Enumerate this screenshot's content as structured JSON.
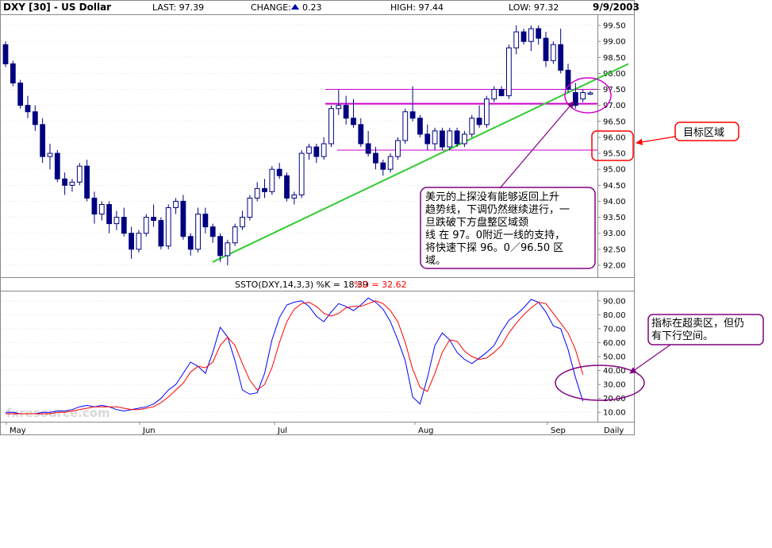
{
  "header": {
    "title": "DXY [30] - US Dollar",
    "last": "LAST: 97.39",
    "change_label": "CHANGE:",
    "change_value": "0.23",
    "high": "HIGH: 97.44",
    "low": "LOW: 97.32",
    "date": "9/9/2003"
  },
  "indicator_header": {
    "label": "SSTO(DXY,14,3,3) %K = 18.39",
    "d_label": "%D = 32.62"
  },
  "x_axis": {
    "labels": [
      "May",
      "Jun",
      "Jul",
      "Aug",
      "Sep"
    ],
    "period": "Daily"
  },
  "watermark": "fxresource.com",
  "annotations": {
    "target_zone": "目标区域",
    "main_note": [
      "美元的上探没有能够返回上升",
      "趋势线，下调仍然继续进行，一",
      "旦跌破下方盘整区域颈",
      "线  在  97。0附近一线的支持，",
      "将快速下探  96。0／96.50  区",
      "域。"
    ],
    "indicator_note": [
      "指标在超卖区，但仍",
      "有下行空间。"
    ]
  },
  "colors": {
    "candle": "#000080",
    "trendline": "#33cc33",
    "resistance": "#cc00cc",
    "k_line": "#0000ff",
    "d_line": "#ff0000",
    "annotation": "#800080",
    "target": "#ff0000"
  },
  "chart_data": [
    {
      "type": "candlestick",
      "title": "DXY [30] - US Dollar",
      "period": "Daily",
      "y_ticks": [
        "99.50",
        "99.00",
        "98.50",
        "98.00",
        "97.50",
        "97.00",
        "96.50",
        "96.00",
        "95.50",
        "95.00",
        "94.50",
        "94.00",
        "93.50",
        "93.00",
        "92.50",
        "92.00"
      ],
      "ylim": [
        91.8,
        99.7
      ],
      "x_labels": [
        "May",
        "Jun",
        "Jul",
        "Aug",
        "Sep"
      ],
      "ohlc": [
        [
          98.9,
          99.0,
          98.2,
          98.3
        ],
        [
          98.3,
          98.4,
          97.6,
          97.7
        ],
        [
          97.7,
          97.8,
          96.9,
          97.0
        ],
        [
          97.0,
          97.3,
          96.6,
          96.8
        ],
        [
          96.8,
          97.0,
          96.2,
          96.4
        ],
        [
          96.4,
          96.6,
          95.2,
          95.4
        ],
        [
          95.4,
          95.8,
          95.0,
          95.5
        ],
        [
          95.5,
          95.6,
          94.6,
          94.7
        ],
        [
          94.7,
          94.9,
          94.2,
          94.5
        ],
        [
          94.5,
          94.7,
          94.3,
          94.6
        ],
        [
          94.6,
          95.2,
          94.5,
          95.1
        ],
        [
          95.1,
          95.3,
          94.0,
          94.1
        ],
        [
          94.1,
          94.3,
          93.3,
          93.6
        ],
        [
          93.6,
          94.0,
          93.4,
          93.9
        ],
        [
          93.9,
          94.0,
          93.0,
          93.3
        ],
        [
          93.3,
          93.7,
          93.1,
          93.5
        ],
        [
          93.5,
          93.8,
          92.9,
          93.0
        ],
        [
          93.0,
          93.2,
          92.2,
          92.5
        ],
        [
          92.5,
          93.1,
          92.4,
          93.0
        ],
        [
          93.0,
          93.6,
          92.9,
          93.5
        ],
        [
          93.5,
          93.9,
          93.2,
          93.4
        ],
        [
          93.4,
          93.5,
          92.5,
          92.6
        ],
        [
          92.6,
          93.9,
          92.5,
          93.8
        ],
        [
          93.8,
          94.1,
          93.6,
          94.0
        ],
        [
          94.0,
          94.2,
          92.8,
          92.9
        ],
        [
          92.9,
          93.0,
          92.3,
          92.5
        ],
        [
          92.5,
          93.8,
          92.4,
          93.6
        ],
        [
          93.6,
          93.8,
          93.0,
          93.2
        ],
        [
          93.2,
          93.3,
          92.7,
          92.9
        ],
        [
          92.9,
          93.0,
          92.1,
          92.3
        ],
        [
          92.3,
          92.8,
          92.0,
          92.7
        ],
        [
          92.7,
          93.3,
          92.6,
          93.2
        ],
        [
          93.2,
          93.7,
          93.1,
          93.5
        ],
        [
          93.5,
          94.2,
          93.4,
          94.1
        ],
        [
          94.1,
          94.6,
          94.0,
          94.4
        ],
        [
          94.4,
          94.7,
          94.1,
          94.3
        ],
        [
          94.3,
          95.1,
          94.2,
          95.0
        ],
        [
          95.0,
          95.2,
          94.7,
          94.8
        ],
        [
          94.8,
          94.9,
          94.0,
          94.1
        ],
        [
          94.1,
          94.3,
          93.9,
          94.2
        ],
        [
          94.2,
          95.6,
          94.1,
          95.5
        ],
        [
          95.5,
          95.8,
          95.3,
          95.7
        ],
        [
          95.7,
          95.8,
          95.2,
          95.4
        ],
        [
          95.4,
          96.0,
          95.3,
          95.8
        ],
        [
          95.8,
          97.0,
          95.7,
          96.9
        ],
        [
          96.9,
          97.5,
          96.7,
          97.0
        ],
        [
          97.0,
          97.3,
          96.4,
          96.6
        ],
        [
          96.6,
          97.2,
          96.3,
          96.4
        ],
        [
          96.4,
          96.6,
          95.7,
          95.8
        ],
        [
          95.8,
          96.2,
          95.4,
          95.5
        ],
        [
          95.5,
          95.7,
          95.0,
          95.2
        ],
        [
          95.2,
          95.3,
          94.8,
          95.0
        ],
        [
          95.0,
          95.5,
          94.9,
          95.4
        ],
        [
          95.4,
          96.0,
          95.3,
          95.9
        ],
        [
          95.9,
          96.9,
          95.8,
          96.8
        ],
        [
          96.8,
          97.6,
          96.5,
          96.6
        ],
        [
          96.6,
          96.7,
          96.0,
          96.1
        ],
        [
          96.1,
          96.4,
          95.6,
          95.8
        ],
        [
          95.8,
          96.3,
          95.6,
          96.2
        ],
        [
          96.2,
          96.3,
          95.6,
          95.7
        ],
        [
          95.7,
          96.3,
          95.6,
          96.2
        ],
        [
          96.2,
          96.3,
          95.7,
          95.8
        ],
        [
          95.8,
          96.2,
          95.7,
          96.1
        ],
        [
          96.1,
          96.7,
          96.0,
          96.6
        ],
        [
          96.6,
          97.0,
          96.3,
          96.4
        ],
        [
          96.4,
          97.3,
          96.3,
          97.2
        ],
        [
          97.2,
          97.6,
          97.1,
          97.5
        ],
        [
          97.5,
          97.6,
          97.3,
          97.3
        ],
        [
          97.3,
          98.9,
          97.2,
          98.8
        ],
        [
          98.8,
          99.5,
          98.6,
          99.3
        ],
        [
          99.3,
          99.4,
          98.9,
          99.0
        ],
        [
          99.0,
          99.5,
          98.7,
          99.4
        ],
        [
          99.4,
          99.5,
          98.9,
          99.1
        ],
        [
          99.1,
          99.3,
          98.2,
          98.4
        ],
        [
          98.4,
          99.0,
          98.3,
          98.9
        ],
        [
          98.9,
          99.4,
          98.0,
          98.1
        ],
        [
          98.1,
          98.3,
          97.4,
          97.5
        ],
        [
          97.4,
          97.7,
          96.9,
          97.0
        ],
        [
          97.2,
          97.5,
          97.1,
          97.4
        ],
        [
          97.35,
          97.45,
          97.32,
          97.39
        ]
      ],
      "overlays": {
        "uptrend_start": [
          "Jun",
          92.1
        ],
        "uptrend_end": [
          "Sep",
          98.3
        ],
        "resistance_levels": [
          97.5,
          97.05,
          95.6
        ]
      }
    },
    {
      "type": "line",
      "title": "SSTO(DXY,14,3,3) %K = 18.39 %D = 32.62",
      "y_ticks": [
        "90.00",
        "80.00",
        "70.00",
        "60.00",
        "50.00",
        "40.00",
        "30.00",
        "20.00",
        "10.00"
      ],
      "ylim": [
        5,
        95
      ],
      "series": [
        {
          "name": "%K",
          "values": [
            10,
            10,
            9,
            9,
            9,
            10,
            10,
            11,
            11,
            12,
            14,
            15,
            14,
            15,
            14,
            12,
            11,
            12,
            13,
            14,
            16,
            20,
            26,
            30,
            38,
            46,
            43,
            38,
            53,
            71,
            64,
            47,
            26,
            23,
            24,
            38,
            62,
            78,
            87,
            89,
            90,
            86,
            79,
            75,
            82,
            88,
            86,
            83,
            87,
            92,
            89,
            84,
            75,
            62,
            47,
            21,
            16,
            35,
            58,
            67,
            62,
            53,
            48,
            45,
            49,
            53,
            58,
            68,
            76,
            80,
            85,
            91,
            89,
            82,
            72,
            70,
            55,
            35,
            18
          ]
        },
        {
          "name": "%D",
          "values": [
            9,
            9,
            9,
            9,
            9,
            9,
            9,
            10,
            10,
            11,
            12,
            13,
            14,
            14,
            14,
            14,
            13,
            12,
            12,
            13,
            14,
            17,
            21,
            26,
            31,
            39,
            43,
            42,
            46,
            58,
            64,
            58,
            45,
            33,
            26,
            30,
            42,
            60,
            75,
            84,
            88,
            89,
            86,
            81,
            79,
            81,
            85,
            86,
            86,
            88,
            90,
            88,
            83,
            75,
            60,
            41,
            28,
            25,
            38,
            53,
            62,
            61,
            54,
            50,
            48,
            49,
            53,
            58,
            67,
            74,
            80,
            85,
            89,
            88,
            81,
            74,
            67,
            55,
            37
          ]
        }
      ]
    }
  ]
}
